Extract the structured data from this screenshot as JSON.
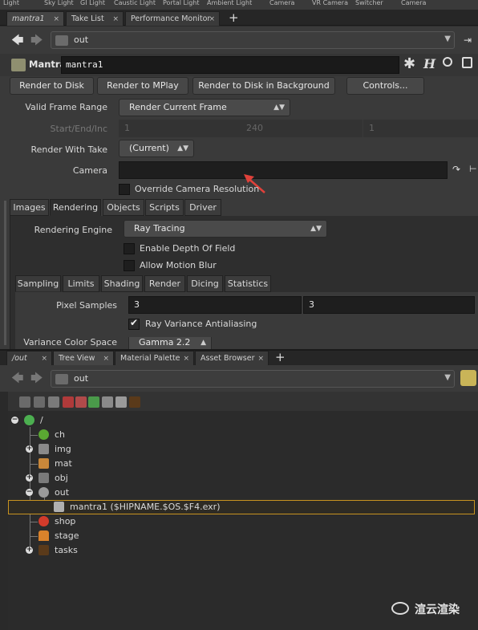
{
  "shelf": [
    "Light",
    "Sky Light",
    "GI Light",
    "Caustic Light",
    "Portal Light",
    "Ambient Light",
    "Camera",
    "VR Camera",
    "Switcher",
    "Camera"
  ],
  "top_tabs": [
    {
      "label": "mantra1",
      "italic": true
    },
    {
      "label": "Take List"
    },
    {
      "label": "Performance Monitor"
    }
  ],
  "close_glyph": "×",
  "add_tab_glyph": "+",
  "path": "out",
  "node": {
    "type": "Mantra",
    "name": "mantra1"
  },
  "actions": [
    "Render to Disk",
    "Render to MPlay",
    "Render to Disk in Background",
    "Controls..."
  ],
  "params": {
    "valid_frame_range_label": "Valid Frame Range",
    "valid_frame_range_value": "Render Current Frame",
    "start_end_inc_label": "Start/End/Inc",
    "start": "1",
    "end": "240",
    "inc": "1",
    "render_with_take_label": "Render With Take",
    "render_with_take_value": "(Current)",
    "camera_label": "Camera",
    "camera_value": "",
    "override_cam_label": "Override Camera Resolution"
  },
  "main_tabs": [
    "Images",
    "Rendering",
    "Objects",
    "Scripts",
    "Driver"
  ],
  "rendering": {
    "engine_label": "Rendering Engine",
    "engine_value": "Ray Tracing",
    "dof_label": "Enable Depth Of Field",
    "motion_blur_label": "Allow Motion Blur"
  },
  "sub_tabs": [
    "Sampling",
    "Limits",
    "Shading",
    "Render",
    "Dicing",
    "Statistics"
  ],
  "sampling": {
    "pixel_samples_label": "Pixel Samples",
    "pixel_samples_x": "3",
    "pixel_samples_y": "3",
    "ray_variance_label": "Ray Variance Antialiasing",
    "variance_color_space_label": "Variance Color Space",
    "variance_color_space_value": "Gamma 2.2"
  },
  "bottom_tabs": [
    "/out",
    "Tree View",
    "Material Palette",
    "Asset Browser"
  ],
  "tree_path": "out",
  "tree": [
    {
      "label": "/",
      "color": "#4caf50"
    },
    {
      "label": "ch",
      "color": "#5aa832"
    },
    {
      "label": "img",
      "color": "#8a8a8a"
    },
    {
      "label": "mat",
      "color": "#c8873a"
    },
    {
      "label": "obj",
      "color": "#7a7a7a"
    },
    {
      "label": "out",
      "color": "#9a9a9a"
    },
    {
      "label": "mantra1 ($HIPNAME.$OS.$F4.exr)",
      "color": "#b0b0b0"
    },
    {
      "label": "shop",
      "color": "#d23b2b"
    },
    {
      "label": "stage",
      "color": "#d9822b"
    },
    {
      "label": "tasks",
      "color": "#5a3a1a"
    }
  ],
  "watermark": "渲云渲染",
  "colors": {
    "selected_outline": "#c89320",
    "arrow": "#e0413a"
  }
}
